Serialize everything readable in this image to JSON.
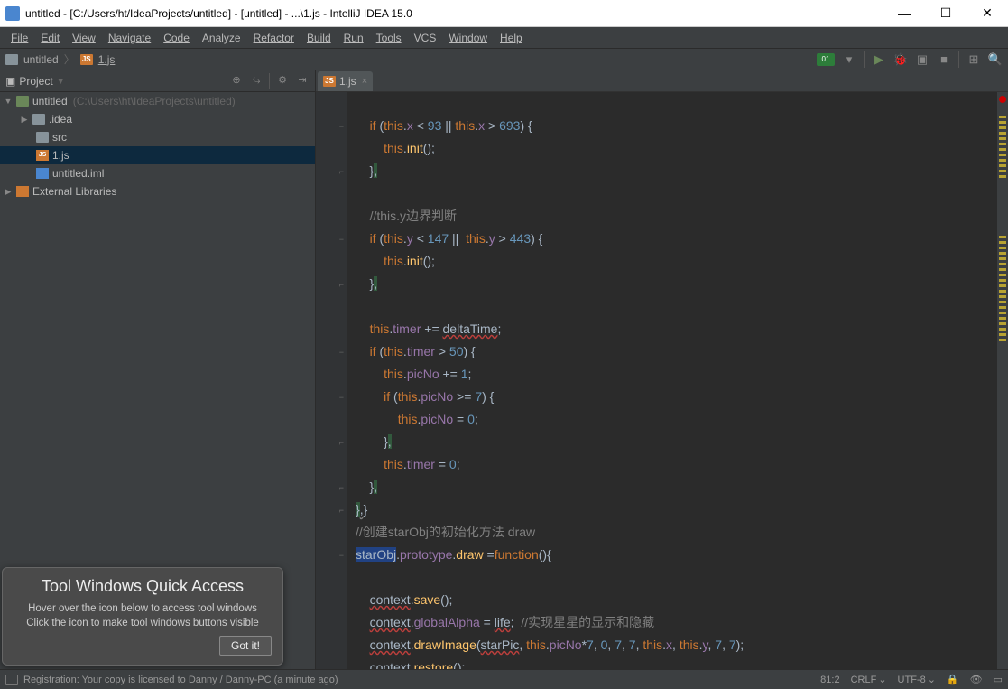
{
  "titlebar": {
    "text": "untitled - [C:/Users/ht/IdeaProjects/untitled] - [untitled] - ...\\1.js - IntelliJ IDEA 15.0"
  },
  "menubar": [
    "File",
    "Edit",
    "View",
    "Navigate",
    "Code",
    "Analyze",
    "Refactor",
    "Build",
    "Run",
    "Tools",
    "VCS",
    "Window",
    "Help"
  ],
  "navbar": {
    "crumb1": "untitled",
    "crumb2": "1.js",
    "badge": "01\n10"
  },
  "sidebar": {
    "title": "Project",
    "tree": {
      "root": "untitled",
      "root_hint": "(C:\\Users\\ht\\IdeaProjects\\untitled)",
      "idea": ".idea",
      "src": "src",
      "file_js": "1.js",
      "file_iml": "untitled.iml",
      "ext_lib": "External Libraries"
    }
  },
  "tooltip": {
    "title": "Tool Windows Quick Access",
    "line1": "Hover over the icon below to access tool windows",
    "line2": "Click the icon to make tool windows buttons visible",
    "button": "Got it!"
  },
  "tab": {
    "label": "1.js"
  },
  "code_lines": [
    "",
    "    if (this.x < 93 || this.x > 693) {",
    "        this.init();",
    "    },",
    "",
    "    //this.y边界判断",
    "    if (this.y < 147 ||  this.y > 443) {",
    "        this.init();",
    "    },",
    "",
    "    this.timer += deltaTime;",
    "    if (this.timer > 50) {",
    "        this.picNo += 1;",
    "        if (this.picNo >= 7) {",
    "            this.picNo = 0;",
    "        },",
    "        this.timer = 0;",
    "    },",
    "},}",
    "//创建starObj的初始化方法 draw",
    "starObj.prototype.draw =function(){",
    "",
    "    context.save();",
    "    context.globalAlpha = life;  //实现星星的显示和隐藏",
    "    context.drawImage(starPic, this.picNo*7, 0, 7, 7, this.x, this.y, 7, 7);",
    "    context.restore();"
  ],
  "statusbar": {
    "message": "Registration: Your copy is licensed to Danny / Danny-PC (a minute ago)",
    "position": "81:2",
    "line_sep": "CRLF",
    "encoding": "UTF-8"
  }
}
